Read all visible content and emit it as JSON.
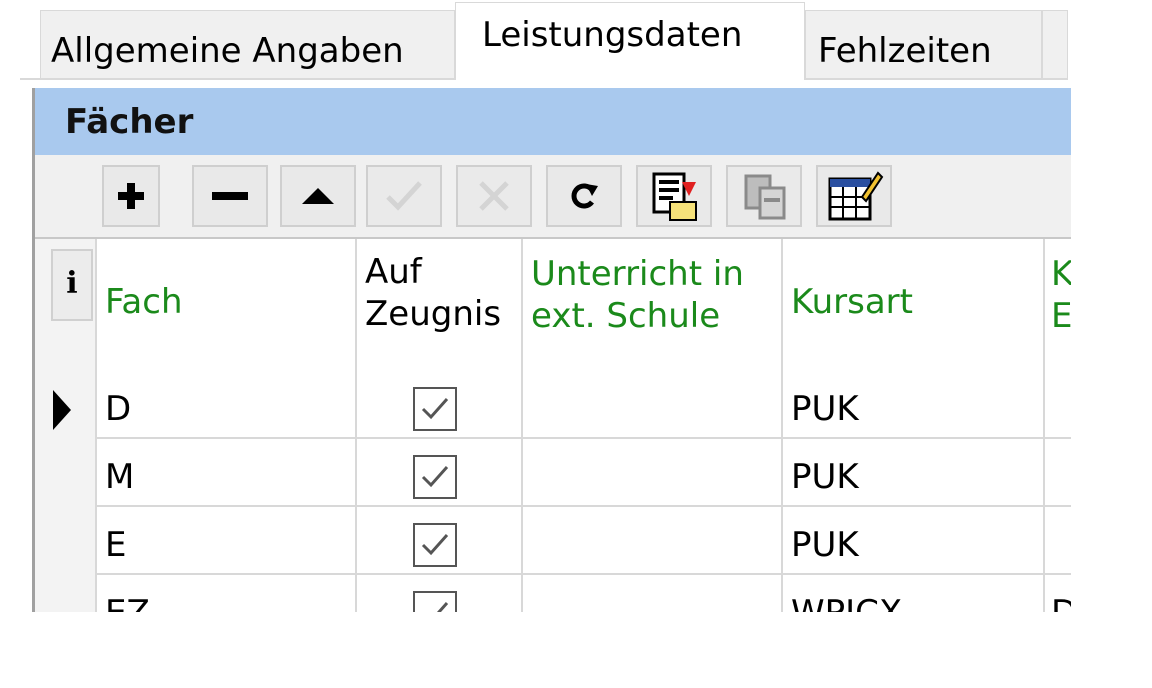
{
  "tabs": [
    {
      "label": "Allgemeine Angaben",
      "active": false
    },
    {
      "label": "Leistungsdaten",
      "active": true
    },
    {
      "label": "Fehlzeiten",
      "active": false
    }
  ],
  "panel": {
    "title": "Fächer",
    "toolbar": [
      {
        "name": "add",
        "icon": "plus-icon",
        "enabled": true
      },
      {
        "name": "remove",
        "icon": "minus-icon",
        "enabled": true
      },
      {
        "name": "move-up",
        "icon": "triangle-up-icon",
        "enabled": true
      },
      {
        "name": "confirm",
        "icon": "check-icon",
        "enabled": false
      },
      {
        "name": "cancel",
        "icon": "x-icon",
        "enabled": false
      },
      {
        "name": "refresh",
        "icon": "refresh-icon",
        "enabled": true
      },
      {
        "name": "import",
        "icon": "document-import-icon",
        "enabled": true
      },
      {
        "name": "copy",
        "icon": "copy-icon",
        "enabled": false
      },
      {
        "name": "edit-table",
        "icon": "table-edit-icon",
        "enabled": true
      }
    ]
  },
  "grid": {
    "info_label": "i",
    "columns": [
      {
        "label": "Fach",
        "color": "#1b8a1b"
      },
      {
        "label_line1": "Auf",
        "label_line2": "Zeugnis",
        "color": "#000000"
      },
      {
        "label_line1": "Unterricht in",
        "label_line2": "ext. Schule",
        "color": "#1b8a1b"
      },
      {
        "label": "Kursart",
        "color": "#1b8a1b"
      },
      {
        "label_line1": "K",
        "label_line2": "E",
        "color": "#1b8a1b"
      }
    ],
    "rows": [
      {
        "fach": "D",
        "auf_zeugnis": true,
        "ext_schule": "",
        "kursart": "PUK",
        "extra": "",
        "current": true
      },
      {
        "fach": "M",
        "auf_zeugnis": true,
        "ext_schule": "",
        "kursart": "PUK",
        "extra": ""
      },
      {
        "fach": "E",
        "auf_zeugnis": true,
        "ext_schule": "",
        "kursart": "PUK",
        "extra": ""
      },
      {
        "fach": "EZ",
        "auf_zeugnis": true,
        "ext_schule": "",
        "kursart": "WPICX",
        "extra": "D"
      }
    ]
  }
}
